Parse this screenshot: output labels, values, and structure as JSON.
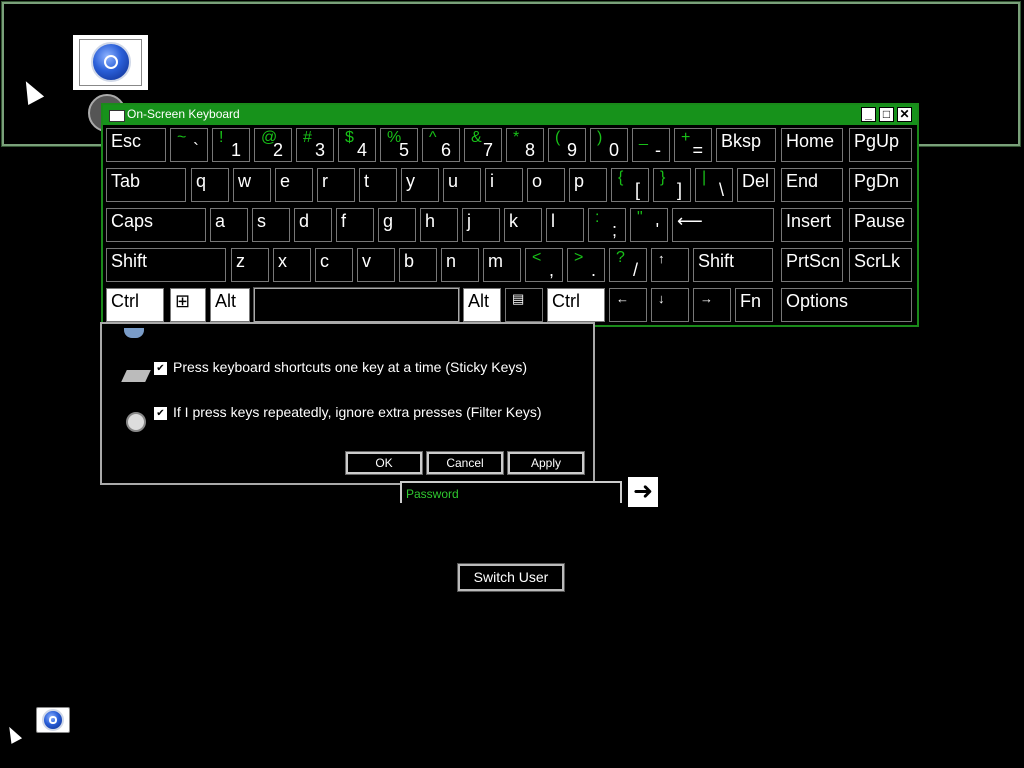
{
  "osk": {
    "title": "On-Screen Keyboard",
    "minimize": "_",
    "restore": "□",
    "close": "✕",
    "rows": [
      [
        {
          "name": "esc",
          "label": "Esc"
        },
        {
          "name": "backtick",
          "top": "~",
          "bot": "`"
        },
        {
          "name": "1",
          "top": "!",
          "bot": "1"
        },
        {
          "name": "2",
          "top": "@",
          "bot": "2"
        },
        {
          "name": "3",
          "top": "#",
          "bot": "3"
        },
        {
          "name": "4",
          "top": "$",
          "bot": "4"
        },
        {
          "name": "5",
          "top": "%",
          "bot": "5"
        },
        {
          "name": "6",
          "top": "^",
          "bot": "6"
        },
        {
          "name": "7",
          "top": "&",
          "bot": "7"
        },
        {
          "name": "8",
          "top": "*",
          "bot": "8"
        },
        {
          "name": "9",
          "top": "(",
          "bot": "9"
        },
        {
          "name": "0",
          "top": ")",
          "bot": "0"
        },
        {
          "name": "minus",
          "top": "_",
          "bot": "-"
        },
        {
          "name": "equals",
          "top": "+",
          "bot": "="
        },
        {
          "name": "bksp",
          "label": "Bksp"
        },
        {
          "name": "home",
          "label": "Home"
        },
        {
          "name": "pgup",
          "label": "PgUp"
        }
      ],
      [
        {
          "name": "tab",
          "label": "Tab"
        },
        {
          "name": "q",
          "label": "q"
        },
        {
          "name": "w",
          "label": "w"
        },
        {
          "name": "e",
          "label": "e"
        },
        {
          "name": "r",
          "label": "r"
        },
        {
          "name": "t",
          "label": "t"
        },
        {
          "name": "y",
          "label": "y"
        },
        {
          "name": "u",
          "label": "u"
        },
        {
          "name": "i",
          "label": "i"
        },
        {
          "name": "o",
          "label": "o"
        },
        {
          "name": "p",
          "label": "p"
        },
        {
          "name": "lbracket",
          "top": "{",
          "bot": "["
        },
        {
          "name": "rbracket",
          "top": "}",
          "bot": "]"
        },
        {
          "name": "backslash",
          "top": "|",
          "bot": "\\"
        },
        {
          "name": "del",
          "label": "Del"
        },
        {
          "name": "end",
          "label": "End"
        },
        {
          "name": "pgdn",
          "label": "PgDn"
        }
      ],
      [
        {
          "name": "caps",
          "label": "Caps"
        },
        {
          "name": "a",
          "label": "a"
        },
        {
          "name": "s",
          "label": "s"
        },
        {
          "name": "d",
          "label": "d"
        },
        {
          "name": "f",
          "label": "f"
        },
        {
          "name": "g",
          "label": "g"
        },
        {
          "name": "h",
          "label": "h"
        },
        {
          "name": "j",
          "label": "j"
        },
        {
          "name": "k",
          "label": "k"
        },
        {
          "name": "l",
          "label": "l"
        },
        {
          "name": "semicolon",
          "top": ":",
          "bot": ";"
        },
        {
          "name": "quote",
          "top": "\"",
          "bot": "'"
        },
        {
          "name": "enter",
          "label": "⟵"
        },
        {
          "name": "insert",
          "label": "Insert"
        },
        {
          "name": "pause",
          "label": "Pause"
        }
      ],
      [
        {
          "name": "lshift",
          "label": "Shift"
        },
        {
          "name": "z",
          "label": "z"
        },
        {
          "name": "x",
          "label": "x"
        },
        {
          "name": "c",
          "label": "c"
        },
        {
          "name": "v",
          "label": "v"
        },
        {
          "name": "b",
          "label": "b"
        },
        {
          "name": "n",
          "label": "n"
        },
        {
          "name": "m",
          "label": "m"
        },
        {
          "name": "comma",
          "top": "<",
          "bot": ","
        },
        {
          "name": "period",
          "top": ">",
          "bot": "."
        },
        {
          "name": "slash",
          "top": "?",
          "bot": "/"
        },
        {
          "name": "up",
          "label": "↑"
        },
        {
          "name": "rshift",
          "label": "Shift"
        },
        {
          "name": "prtscn",
          "label": "PrtScn"
        },
        {
          "name": "scrlk",
          "label": "ScrLk"
        }
      ],
      [
        {
          "name": "lctrl",
          "label": "Ctrl"
        },
        {
          "name": "win",
          "label": "⊞"
        },
        {
          "name": "lalt",
          "label": "Alt"
        },
        {
          "name": "space",
          "label": ""
        },
        {
          "name": "ralt",
          "label": "Alt"
        },
        {
          "name": "menu",
          "label": "▤"
        },
        {
          "name": "rctrl",
          "label": "Ctrl"
        },
        {
          "name": "left",
          "label": "←"
        },
        {
          "name": "down",
          "label": "↓"
        },
        {
          "name": "right",
          "label": "→"
        },
        {
          "name": "fn",
          "label": "Fn"
        },
        {
          "name": "options",
          "label": "Options"
        }
      ]
    ]
  },
  "dialog": {
    "sticky_label": "Press keyboard shortcuts one key at a time (Sticky Keys)",
    "sticky_checked": "✔",
    "filter_label": "If I press keys repeatedly, ignore extra presses (Filter Keys)",
    "filter_checked": "✔",
    "ok": "OK",
    "cancel": "Cancel",
    "apply": "Apply"
  },
  "login": {
    "password_placeholder": "Password",
    "submit": "➜",
    "switch_user": "Switch User"
  },
  "colors": {
    "accent": "#17921b",
    "shift_text": "#18c018"
  }
}
